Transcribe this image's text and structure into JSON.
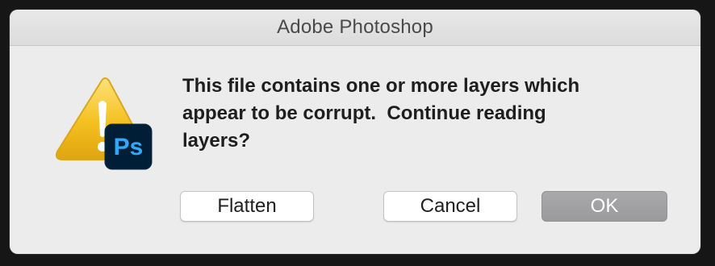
{
  "dialog": {
    "title": "Adobe Photoshop",
    "message": "This file contains one or more layers which\nappear to be corrupt.  Continue reading\nlayers?",
    "icon": {
      "warning": "warning-triangle-icon",
      "badge": "photoshop-app-icon",
      "badge_text": "Ps"
    }
  },
  "buttons": {
    "flatten": "Flatten",
    "cancel": "Cancel",
    "ok": "OK"
  },
  "colors": {
    "ps_badge_bg": "#001e36",
    "ps_badge_text": "#31a8ff",
    "warning_yellow": "#f4c01e"
  }
}
